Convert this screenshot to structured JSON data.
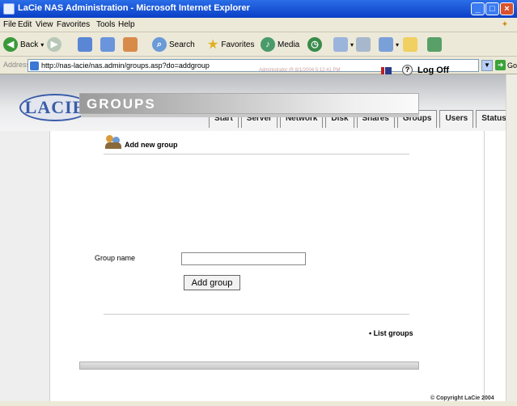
{
  "window": {
    "title": "LaCie NAS Administration - Microsoft Internet Explorer",
    "controls": [
      "minimize",
      "maximize",
      "close"
    ]
  },
  "menu": [
    "File",
    "Edit",
    "View",
    "Favorites",
    "Tools",
    "Help"
  ],
  "toolbar": {
    "back_label": "Back",
    "search_label": "Search",
    "favorites_label": "Favorites",
    "media_label": "Media"
  },
  "address": {
    "label": "Address",
    "url": "http://nas-lacie/nas.admin/groups.asp?do=addgroup",
    "go_label": "Go"
  },
  "page": {
    "logo_text": "LACIE",
    "nav": [
      "Start",
      "Server",
      "Network",
      "Disk",
      "Shares",
      "Groups",
      "Users",
      "Status"
    ],
    "user_info": "Administrator @ 8/1/2004 5:12:41 PM",
    "logoff_label": "Log Off",
    "help_label": "?",
    "banner_title": "GROUPS",
    "section_title": "Add new group",
    "field_label": "Group name",
    "group_name_value": "",
    "add_button_label": "Add group",
    "list_link_label": "List groups",
    "copyright": "© Copyright LaCie 2004"
  }
}
